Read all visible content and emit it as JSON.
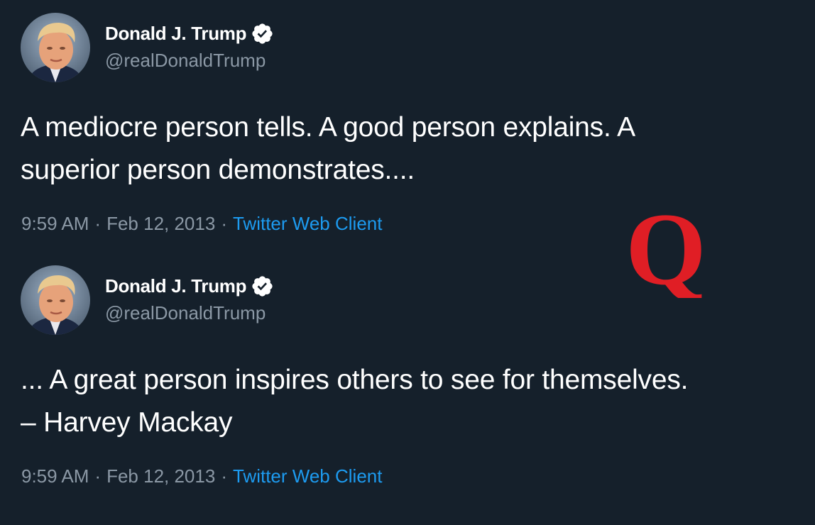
{
  "tweets": [
    {
      "author": {
        "name": "Donald J. Trump",
        "handle": "@realDonaldTrump",
        "verified": true
      },
      "text_lines": [
        "A mediocre person tells. A good person explains. A",
        "superior person demonstrates...."
      ],
      "time": "9:59 AM",
      "date": "Feb 12, 2013",
      "source": "Twitter Web Client",
      "separator": "·"
    },
    {
      "author": {
        "name": "Donald J. Trump",
        "handle": "@realDonaldTrump",
        "verified": true
      },
      "text_lines": [
        "... A great person inspires others to see for themselves.",
        "– Harvey Mackay"
      ],
      "time": "9:59 AM",
      "date": "Feb 12, 2013",
      "source": "Twitter Web Client",
      "separator": "·"
    }
  ],
  "overlay": {
    "letter": "Q",
    "color": "#e01e25"
  },
  "colors": {
    "background": "#15202b",
    "text_primary": "#ffffff",
    "text_secondary": "#8b98a5",
    "link": "#1d9bf0",
    "verified_badge": "#ffffff"
  },
  "icons": {
    "verified": "verified-badge-icon",
    "avatar": "avatar"
  }
}
